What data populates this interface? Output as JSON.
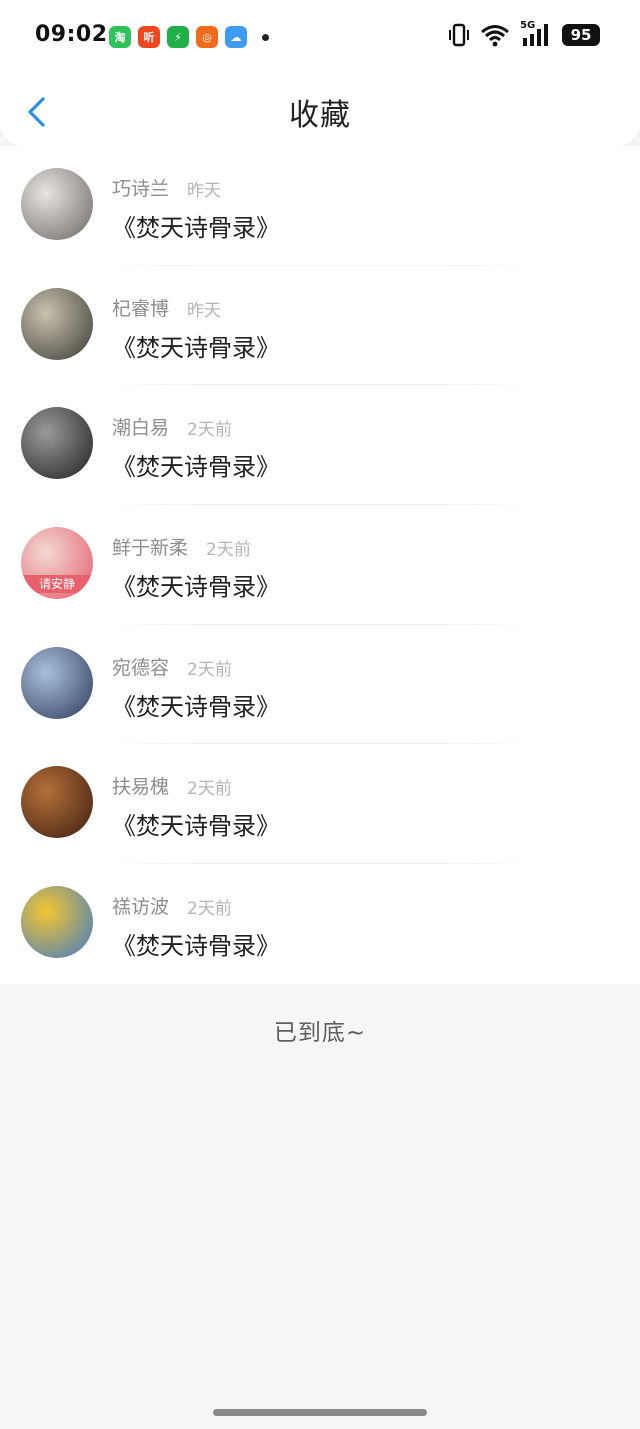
{
  "status_bar": {
    "time": "09:02",
    "app_icons": [
      {
        "name": "taobao-icon",
        "color": "#2ec25b",
        "glyph": "淘"
      },
      {
        "name": "listen-app-icon",
        "color": "#f0471f",
        "glyph": "听"
      },
      {
        "name": "shield-app-icon",
        "color": "#20b04a",
        "glyph": "⚡"
      },
      {
        "name": "video-app-icon",
        "color": "#f26b1d",
        "glyph": "◎"
      },
      {
        "name": "weather-app-icon",
        "color": "#3d9bf2",
        "glyph": "☁"
      }
    ],
    "network": "5G",
    "battery": "95"
  },
  "nav": {
    "title": "收藏",
    "accent": "#2b8fe6"
  },
  "favorites": [
    {
      "name": "巧诗兰",
      "time": "昨天",
      "book": "《焚天诗骨录》",
      "avatar_colors": [
        "#e8e4e2",
        "#6b6663"
      ]
    },
    {
      "name": "杞睿博",
      "time": "昨天",
      "book": "《焚天诗骨录》",
      "avatar_colors": [
        "#c9c2b0",
        "#3b3a34"
      ]
    },
    {
      "name": "潮白易",
      "time": "2天前",
      "book": "《焚天诗骨录》",
      "avatar_colors": [
        "#9a9a9a",
        "#1f1f1f"
      ]
    },
    {
      "name": "鲜于新柔",
      "time": "2天前",
      "book": "《焚天诗骨录》",
      "avatar_colors": [
        "#f3d9d4",
        "#e45a6a"
      ],
      "avatar_caption": "请安静"
    },
    {
      "name": "宛德容",
      "time": "2天前",
      "book": "《焚天诗骨录》",
      "avatar_colors": [
        "#a9c0de",
        "#2d3b59"
      ]
    },
    {
      "name": "扶易槐",
      "time": "2天前",
      "book": "《焚天诗骨录》",
      "avatar_colors": [
        "#b5703a",
        "#3d1e10"
      ]
    },
    {
      "name": "禚访波",
      "time": "2天前",
      "book": "《焚天诗骨录》",
      "avatar_colors": [
        "#f3c631",
        "#3f79c9"
      ]
    }
  ],
  "footer": {
    "end_text": "已到底~"
  }
}
